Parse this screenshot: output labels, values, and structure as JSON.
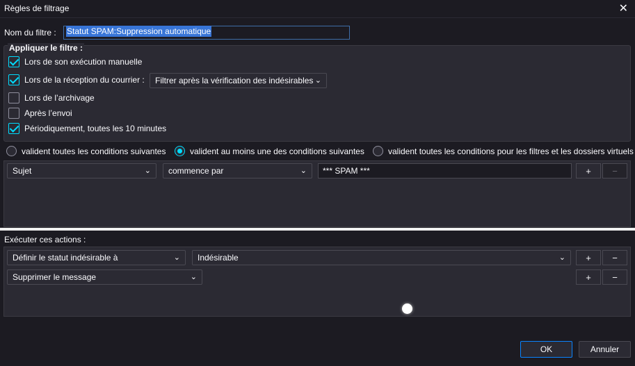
{
  "window": {
    "title": "Règles de filtrage"
  },
  "filter_name": {
    "label": "Nom du filtre :",
    "value": "Statut SPAM:Suppression automatique"
  },
  "apply_group": {
    "title": "Appliquer le filtre :",
    "options": [
      {
        "label": "Lors de son exécution manuelle",
        "checked": true
      },
      {
        "label": "Lors de la réception du courrier :",
        "checked": true
      },
      {
        "label": "Lors de l’archivage",
        "checked": false
      },
      {
        "label": "Après l’envoi",
        "checked": false
      },
      {
        "label": "Périodiquement, toutes les 10 minutes",
        "checked": true
      }
    ],
    "reception_dropdown": "Filtrer après la vérification des indésirables"
  },
  "match_mode": {
    "options": [
      {
        "label": "valident toutes les conditions suivantes",
        "selected": false
      },
      {
        "label": "valident au moins une des conditions suivantes",
        "selected": true
      },
      {
        "label": "valident toutes les conditions pour les filtres et les dossiers virtuels",
        "selected": false
      }
    ]
  },
  "condition": {
    "field": "Sujet",
    "operator": "commence par",
    "value": "*** SPAM ***",
    "add": "+",
    "remove": "−"
  },
  "actions": {
    "label": "Exécuter ces actions :",
    "rows": [
      {
        "action": "Définir le statut indésirable à",
        "target": "Indésirable",
        "add": "+",
        "remove": "−"
      },
      {
        "action": "Supprimer le message",
        "add": "+",
        "remove": "−"
      }
    ]
  },
  "buttons": {
    "ok": "OK",
    "cancel": "Annuler"
  },
  "colors": {
    "accent": "#00ddff",
    "background": "#1c1b22",
    "panel": "#2b2a33"
  }
}
